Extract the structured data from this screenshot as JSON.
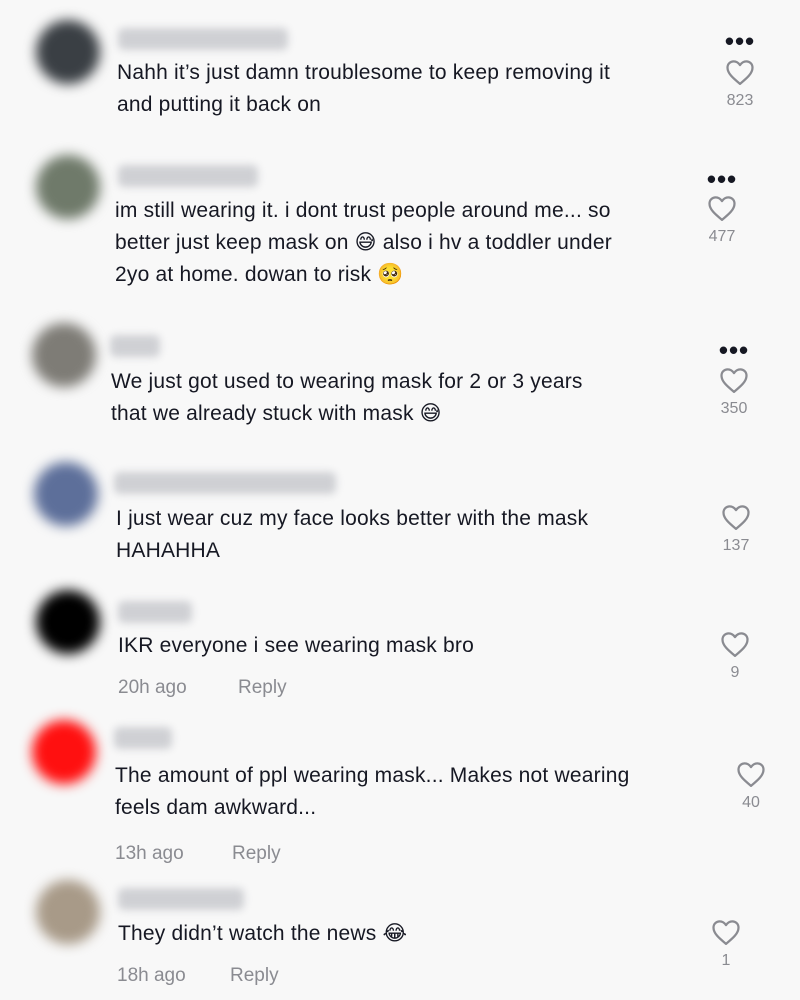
{
  "comments": [
    {
      "text": "Nahh it’s just damn troublesome to keep removing it\nand putting it back on",
      "likes": "823",
      "time": "",
      "reply": "",
      "avatar_color": "#3a3f44"
    },
    {
      "text": "im still wearing it. i dont trust people around me... so\nbetter just keep mask on 😅 also i hv a toddler under\n2yo at home. dowan to risk 🥺",
      "likes": "477",
      "time": "",
      "reply": "",
      "avatar_color": "#6f7a6a"
    },
    {
      "text": "We just got used to wearing mask for 2 or 3 years\nthat we already stuck with mask 😅",
      "likes": "350",
      "time": "",
      "reply": "",
      "avatar_color": "#7e7c76"
    },
    {
      "text": "I just wear cuz my face looks better with the mask\nHAHAHHA",
      "likes": "137",
      "time": "",
      "reply": "",
      "avatar_color": "#5d6f9a"
    },
    {
      "text": "IKR everyone i see wearing mask bro",
      "likes": "9",
      "time": "20h ago",
      "reply": "Reply",
      "avatar_color": "#000000"
    },
    {
      "text": "The amount of ppl wearing mask... Makes not wearing\nfeels dam awkward...",
      "likes": "40",
      "time": "13h ago",
      "reply": "Reply",
      "avatar_color": "#ff1010"
    },
    {
      "text": "They didn’t watch the news 😂",
      "likes": "1",
      "time": "18h ago",
      "reply": "Reply",
      "avatar_color": "#a89a88"
    }
  ],
  "icons": {
    "more": "ellipsis-icon",
    "like": "heart-outline-icon"
  }
}
